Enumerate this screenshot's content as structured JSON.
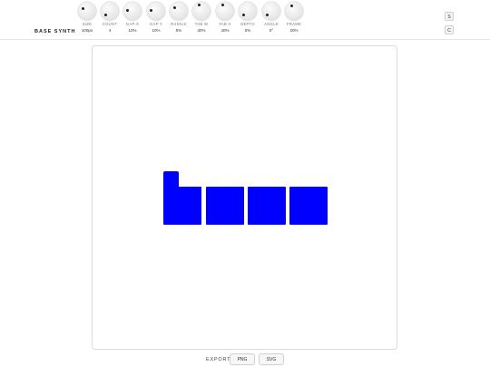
{
  "app": {
    "title": "BASE SYNTH"
  },
  "controls": [
    {
      "label": "SIZE",
      "value": "100px"
    },
    {
      "label": "COUNT",
      "value": "4"
    },
    {
      "label": "GAP X",
      "value": "10%"
    },
    {
      "label": "GAP Y",
      "value": "10%"
    },
    {
      "label": "RADIUS",
      "value": "5%"
    },
    {
      "label": "TAB W",
      "value": "40%"
    },
    {
      "label": "TAB H",
      "value": "40%"
    },
    {
      "label": "DEPTH",
      "value": "0%"
    },
    {
      "label": "ANGLE",
      "value": "0°"
    },
    {
      "label": "FRAME",
      "value": "20%"
    }
  ],
  "side_buttons": {
    "save": "S",
    "clear": "C"
  },
  "export": {
    "label": "EXPORT",
    "png": "PNG",
    "svg": "SVG"
  },
  "colors": {
    "shape_fill": "#0000ff",
    "canvas_bg": "#ffffff"
  },
  "icons": {
    "knob": "rotary-knob-icon"
  }
}
